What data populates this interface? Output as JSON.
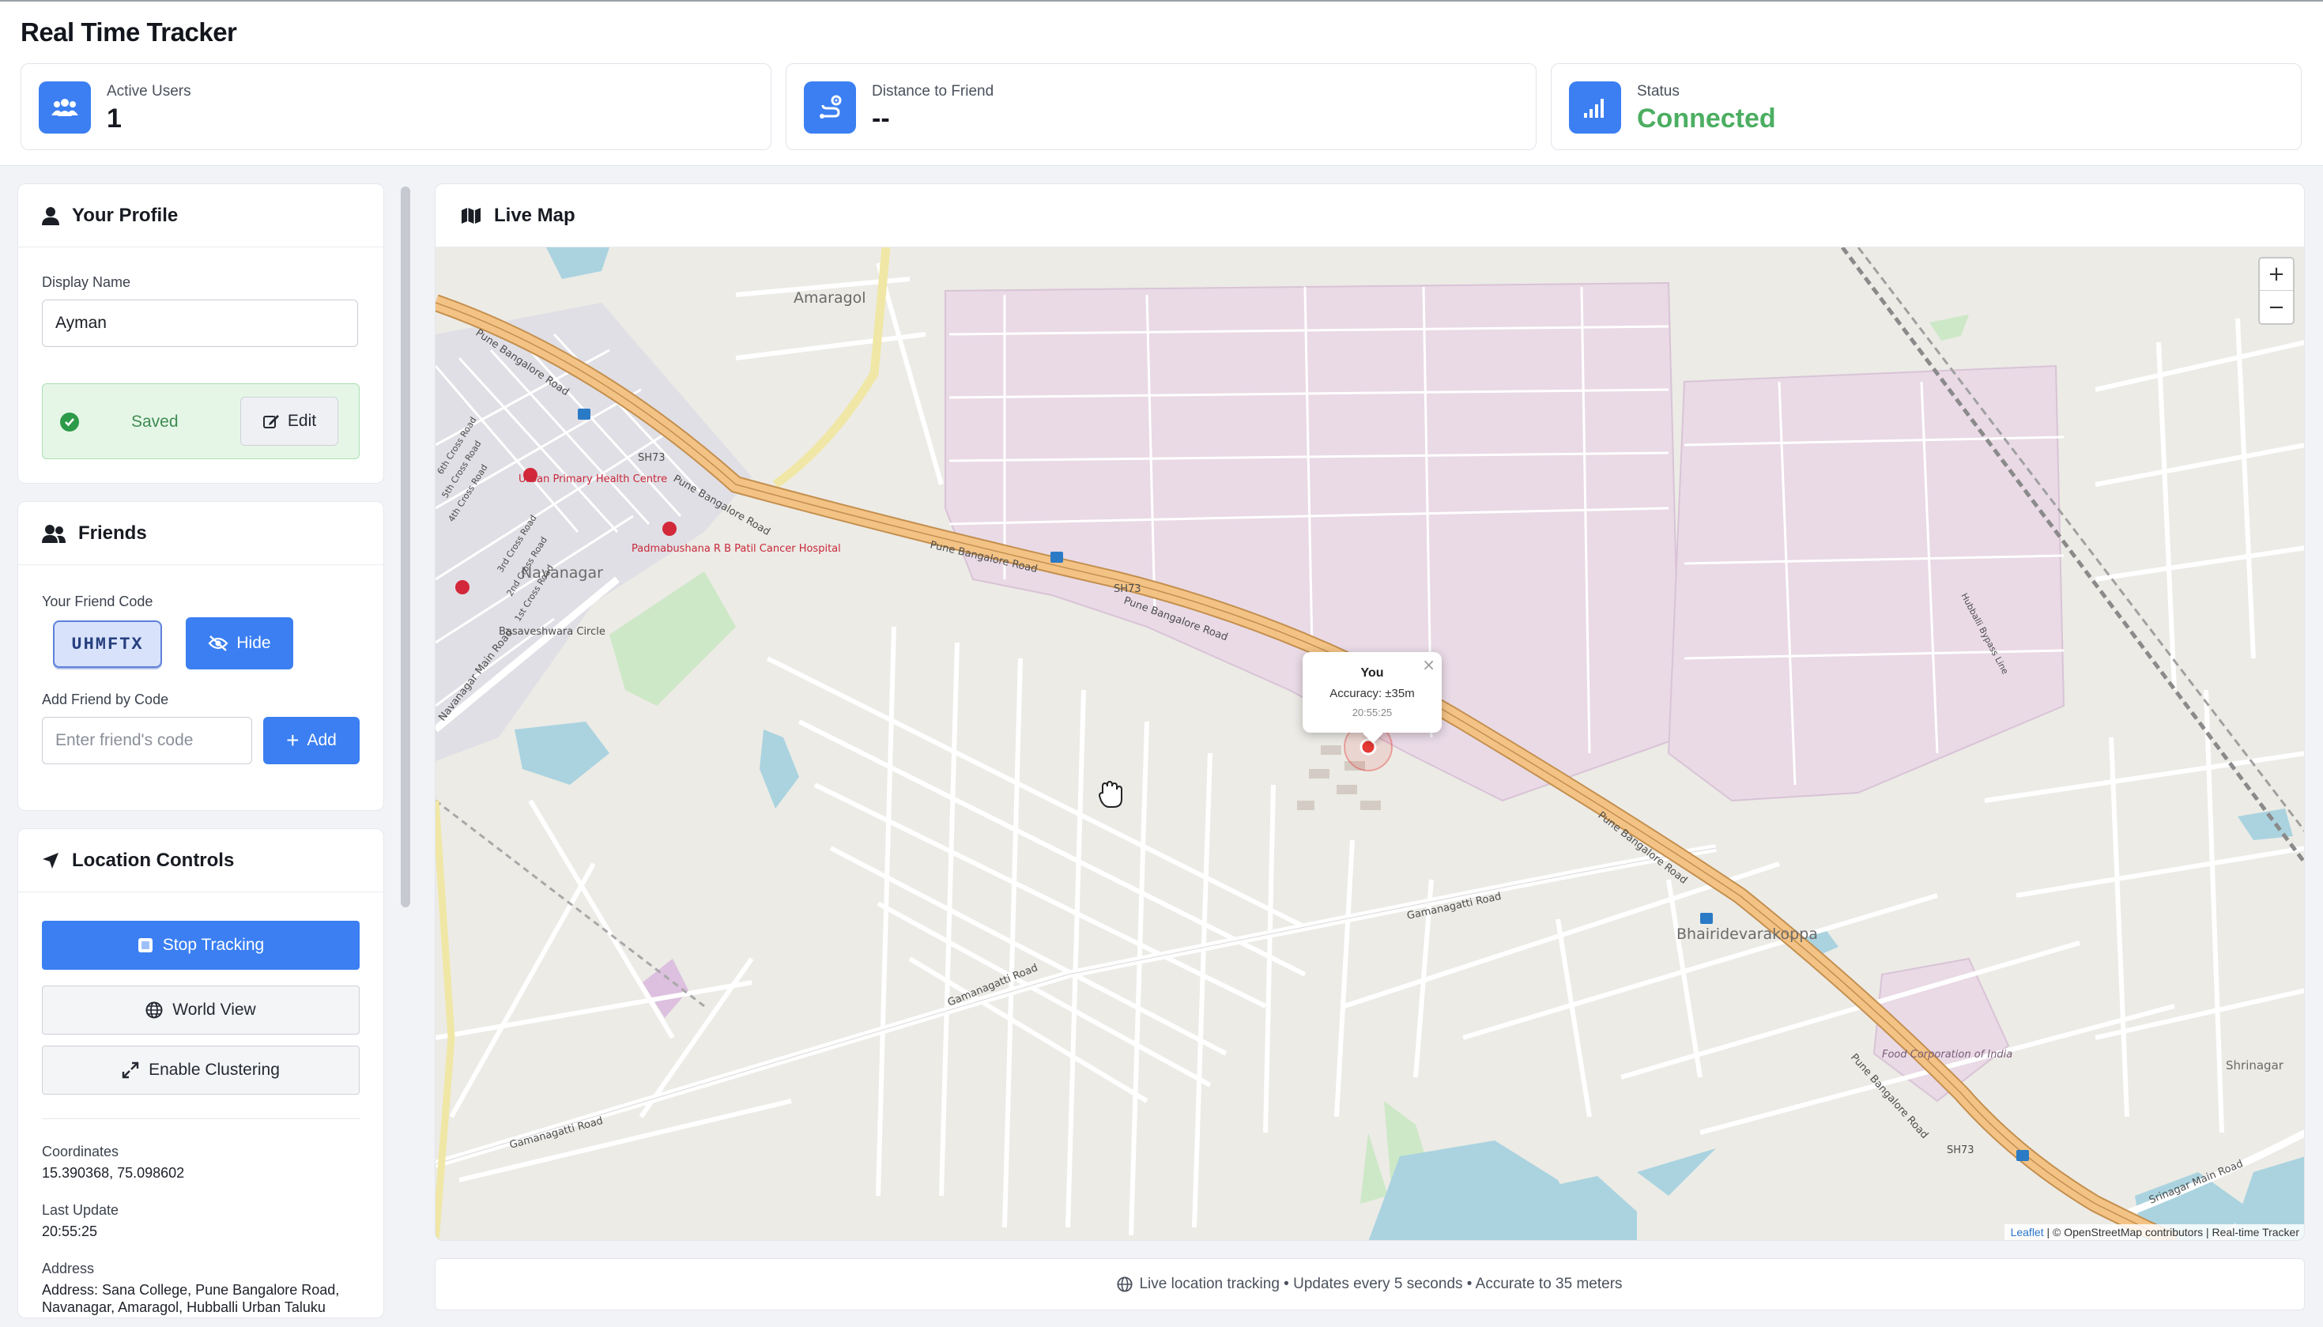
{
  "app": {
    "title": "Real Time Tracker"
  },
  "stats": [
    {
      "label": "Active Users",
      "value": "1",
      "icon": "users-icon"
    },
    {
      "label": "Distance to Friend",
      "value": "--",
      "icon": "route-icon"
    },
    {
      "label": "Status",
      "value": "Connected",
      "icon": "signal-icon",
      "color": "#4cae62"
    }
  ],
  "profile": {
    "heading": "Your Profile",
    "display_name_label": "Display Name",
    "display_name_value": "Ayman",
    "saved_text": "Saved",
    "edit_label": "Edit"
  },
  "friends": {
    "heading": "Friends",
    "code_label": "Your Friend Code",
    "code": "UHMFTX",
    "hide_label": "Hide",
    "add_label": "Add Friend by Code",
    "add_placeholder": "Enter friend's code",
    "add_button": "Add"
  },
  "location": {
    "heading": "Location Controls",
    "stop_tracking": "Stop Tracking",
    "world_view": "World View",
    "enable_clustering": "Enable Clustering",
    "coordinates_label": "Coordinates",
    "coordinates_value": "15.390368, 75.098602",
    "last_update_label": "Last Update",
    "last_update_value": "20:55:25",
    "address_label": "Address",
    "address_value": "Address: Sana College, Pune Bangalore Road, Navanagar, Amaragol, Hubballi Urban Taluku"
  },
  "map": {
    "heading": "Live Map",
    "zoom_in": "+",
    "zoom_out": "−",
    "popup": {
      "title": "You",
      "accuracy": "Accuracy: ±35m",
      "time": "20:55:25",
      "close": "×"
    },
    "attribution_link": "Leaflet",
    "attribution_text": " | © OpenStreetMap contributors | Real-time Tracker",
    "labels": {
      "amaragol": "Amaragol",
      "navanagar": "Navanagar",
      "bhairidevarakoppa": "Bhairidevarakoppa",
      "shrinagar": "Shrinagar",
      "pune_bangalore_road": "Pune Bangalore Road",
      "sh73": "SH73",
      "gamanagatti_road": "Gamanagatti Road",
      "navanagar_main_road": "Navanagar Main Road",
      "srinagar_main_road": "Srinagar Main Road",
      "hubballi_bypass": "Hubballi Bypass Line",
      "uphc": "Urban Primary Health Centre",
      "padmabushana": "Padmabushana R B Patil Cancer Hospital",
      "basaveshwara": "Basaveshwara Circle",
      "food_corp": "Food Corporation of India",
      "cross_roads": [
        "6th Cross Road",
        "5th Cross Road",
        "4th Cross Road",
        "3rd Cross Road",
        "2nd Cross Road",
        "1st Cross Road"
      ]
    },
    "colors": {
      "industrial": "#e9dae6",
      "major_road": "#f3c385",
      "water": "#aad3df",
      "park": "#cde8c6",
      "marker": "#e53935"
    }
  },
  "footer": {
    "text": "Live location tracking • Updates every 5 seconds • Accurate to 35 meters"
  }
}
